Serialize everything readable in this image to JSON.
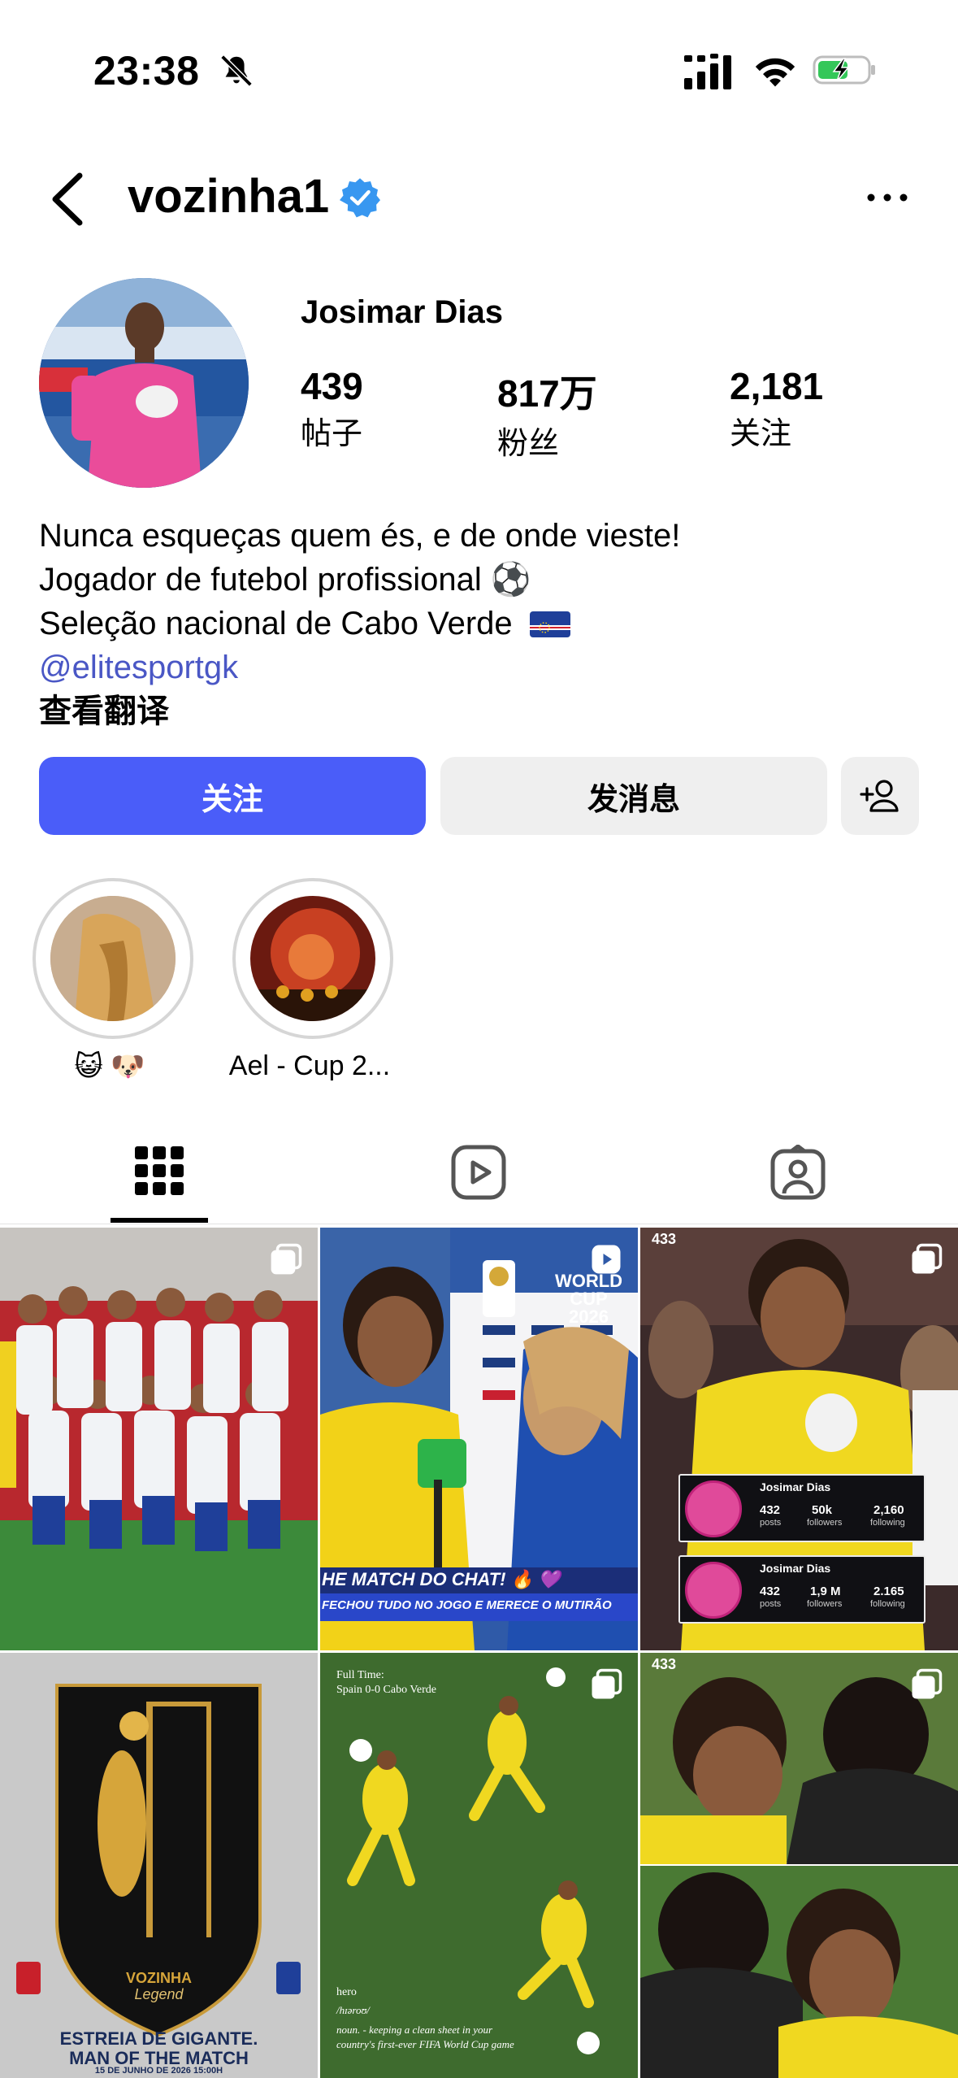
{
  "status_bar": {
    "time": "23:38"
  },
  "header": {
    "username": "vozinha1"
  },
  "profile": {
    "full_name": "Josimar Dias",
    "stats": [
      {
        "value": "439",
        "label": "帖子"
      },
      {
        "value": "817万",
        "label": "粉丝"
      },
      {
        "value": "2,181",
        "label": "关注"
      }
    ],
    "bio": [
      "Nunca esqueças quem és, e de onde vieste!",
      "Jogador de futebol profissional ⚽",
      "Seleção nacional de Cabo Verde"
    ],
    "link": "@elitesportgk",
    "translate": "查看翻译"
  },
  "buttons": {
    "follow": "关注",
    "message": "发消息"
  },
  "highlights": [
    {
      "label": "😺 🐶"
    },
    {
      "label": "Ael - Cup 2..."
    }
  ],
  "tabs": [
    {
      "name": "grid",
      "icon": "grid-icon"
    },
    {
      "name": "reels",
      "icon": "reels-icon"
    },
    {
      "name": "tagged",
      "icon": "tagged-icon"
    }
  ],
  "posts": {
    "p2": {
      "caption_top": "HE MATCH DO CHAT! 🔥 💜",
      "caption_bottom": "FECHOU TUDO NO JOGO E MERECE O MUTIRÃO",
      "brand_line": "WORLD CUP",
      "year": "2026"
    },
    "p3": {
      "card1": {
        "name": "Josimar Dias",
        "posts": "432",
        "followers": "50k",
        "following": "2,160",
        "posts_lbl": "posts",
        "followers_lbl": "followers",
        "following_lbl": "following"
      },
      "card2": {
        "name": "Josimar Dias",
        "posts": "432",
        "followers": "1,9 M",
        "following": "2.165",
        "posts_lbl": "posts",
        "followers_lbl": "followers",
        "following_lbl": "following"
      },
      "tag": "433"
    },
    "p4": {
      "title1": "VOZINHA",
      "title2": "Legend",
      "headline1": "ESTREIA DE GIGANTE.",
      "headline2": "MAN OF THE MATCH",
      "date": "15 DE JUNHO DE 2026",
      "time": "15:00H"
    },
    "p5": {
      "line1": "Full Time:",
      "line2": "Spain 0-0 Cabo Verde",
      "word": "hero",
      "phon": "/hɪəroʊ/",
      "def1": "noun. - keeping a clean sheet in your",
      "def2": "country's first-ever FIFA World Cup game"
    },
    "p6": {
      "tag": "433"
    }
  },
  "colors": {
    "accent": "#4a5df9",
    "link": "#4a57c5",
    "verified": "#3897f0"
  }
}
